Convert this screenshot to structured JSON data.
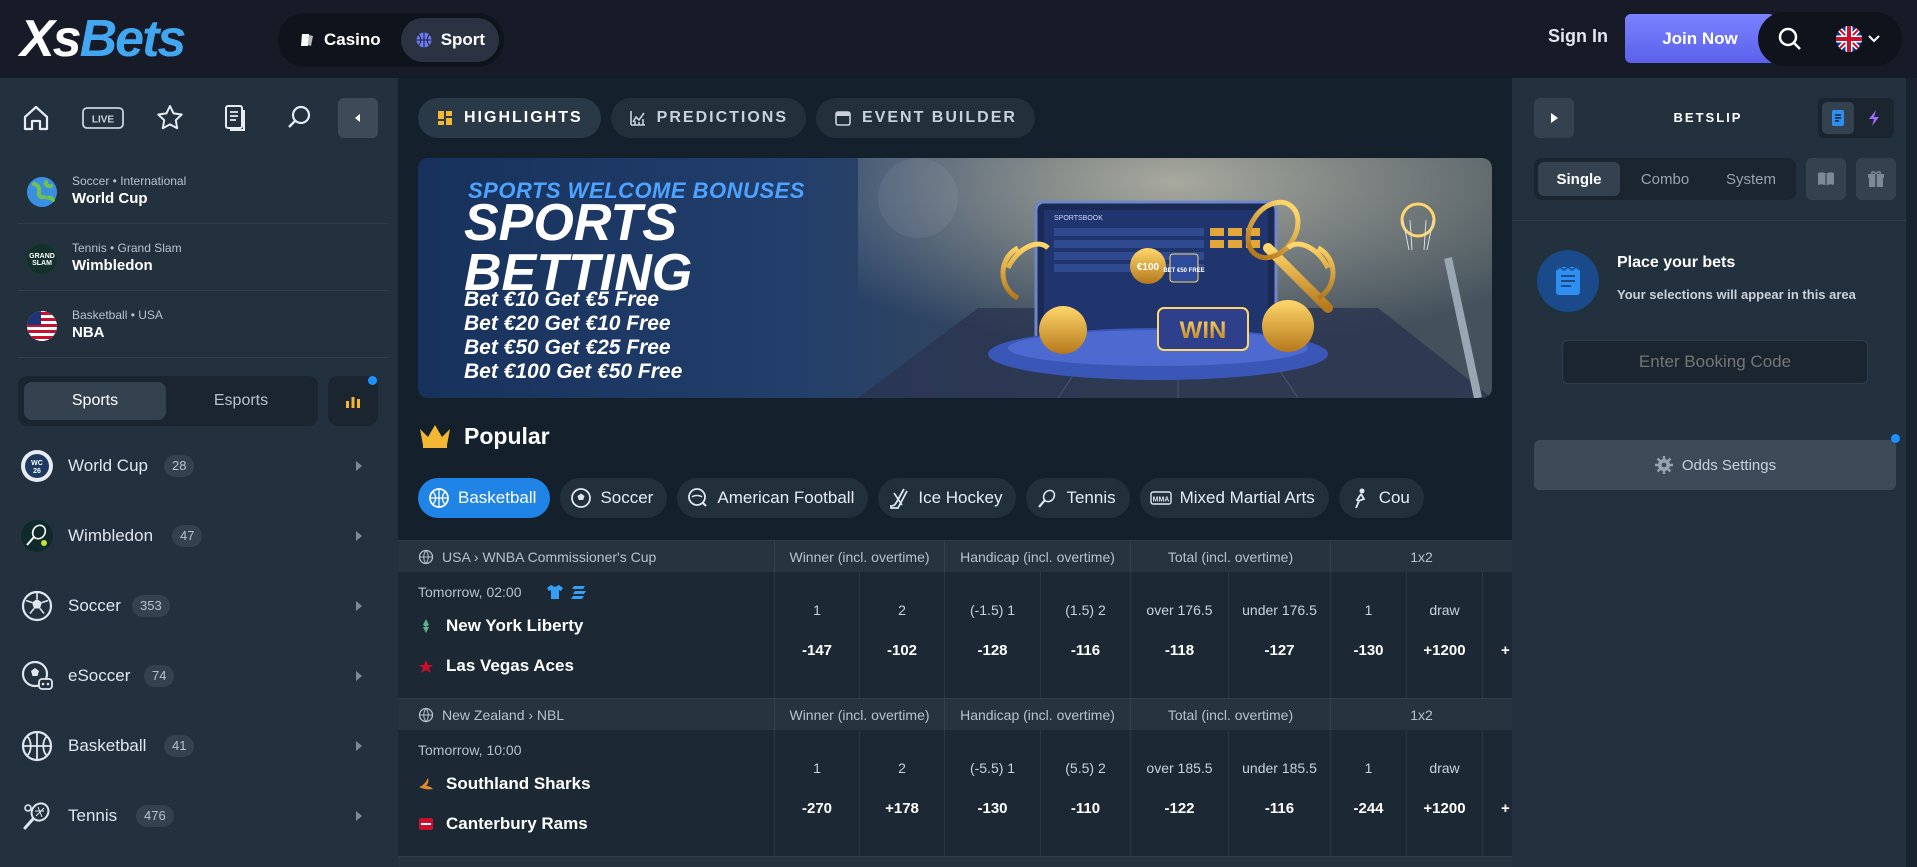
{
  "header": {
    "logo_xs": "Xs",
    "logo_bets": "Bets",
    "products": [
      {
        "label": "Casino",
        "icon": "cards-icon"
      },
      {
        "label": "Sport",
        "icon": "basketball-icon"
      }
    ],
    "sign_in": "Sign In",
    "join_now": "Join Now",
    "language_icon": "uk-flag-icon"
  },
  "left_sidebar": {
    "icons": [
      "home-icon",
      "live-icon",
      "star-icon",
      "betslip-history-icon",
      "search-icon",
      "collapse-icon"
    ],
    "live_label": "LIVE",
    "featured": [
      {
        "subtitle": "Soccer • International",
        "title": "World Cup",
        "icon": "globe-icon"
      },
      {
        "subtitle": "Tennis • Grand Slam",
        "title": "Wimbledon",
        "icon": "grand-slam-icon"
      },
      {
        "subtitle": "Basketball • USA",
        "title": "NBA",
        "icon": "usa-flag-icon"
      }
    ],
    "toggle": {
      "sports": "Sports",
      "esports": "Esports"
    },
    "sports": [
      {
        "name": "World Cup",
        "count": "28",
        "icon": "world-cup-icon"
      },
      {
        "name": "Wimbledon",
        "count": "47",
        "icon": "wimbledon-icon"
      },
      {
        "name": "Soccer",
        "count": "353",
        "icon": "soccer-icon"
      },
      {
        "name": "eSoccer",
        "count": "74",
        "icon": "esoccer-icon"
      },
      {
        "name": "Basketball",
        "count": "41",
        "icon": "basketball-icon"
      },
      {
        "name": "Tennis",
        "count": "476",
        "icon": "tennis-icon"
      }
    ]
  },
  "main": {
    "tabs": [
      {
        "label": "HIGHLIGHTS",
        "icon": "grid-icon"
      },
      {
        "label": "PREDICTIONS",
        "icon": "chart-icon"
      },
      {
        "label": "EVENT BUILDER",
        "icon": "builder-icon"
      }
    ],
    "banner": {
      "small": "SPORTS WELCOME BONUSES",
      "big": "SPORTS BETTING",
      "lines": [
        "Bet €10 Get €5 Free",
        "Bet €20 Get €10 Free",
        "Bet €50 Get €25 Free",
        "Bet €100 Get €50 Free"
      ],
      "screen_title": "SPORTSBOOK",
      "coin_text": "€100",
      "ticket_text": "BET €50 FREE",
      "win_text": "WIN"
    },
    "popular_title": "Popular",
    "sport_chips": [
      "Basketball",
      "Soccer",
      "American Football",
      "Ice Hockey",
      "Tennis",
      "Mixed Martial Arts",
      "Cou"
    ],
    "markets": [
      "Winner (incl. overtime)",
      "Handicap (incl. overtime)",
      "Total (incl. overtime)",
      "1x2"
    ],
    "events": [
      {
        "league": "USA › WNBA Commissioner's Cup",
        "time": "Tomorrow, 02:00",
        "home": "New York Liberty",
        "away": "Las Vegas Aces",
        "odds": [
          {
            "label": "1",
            "value": "-147"
          },
          {
            "label": "2",
            "value": "-102"
          },
          {
            "label": "(-1.5) 1",
            "value": "-128"
          },
          {
            "label": "(1.5) 2",
            "value": "-116"
          },
          {
            "label": "over 176.5",
            "value": "-118"
          },
          {
            "label": "under 176.5",
            "value": "-127"
          },
          {
            "label": "1",
            "value": "-130"
          },
          {
            "label": "draw",
            "value": "+1200"
          },
          {
            "label": "",
            "value": "+"
          }
        ]
      },
      {
        "league": "New Zealand › NBL",
        "time": "Tomorrow, 10:00",
        "home": "Southland Sharks",
        "away": "Canterbury Rams",
        "odds": [
          {
            "label": "1",
            "value": "-270"
          },
          {
            "label": "2",
            "value": "+178"
          },
          {
            "label": "(-5.5) 1",
            "value": "-130"
          },
          {
            "label": "(5.5) 2",
            "value": "-110"
          },
          {
            "label": "over 185.5",
            "value": "-122"
          },
          {
            "label": "under 185.5",
            "value": "-116"
          },
          {
            "label": "1",
            "value": "-244"
          },
          {
            "label": "draw",
            "value": "+1200"
          },
          {
            "label": "",
            "value": "+"
          }
        ]
      }
    ]
  },
  "betslip": {
    "title": "BETSLIP",
    "bet_types": [
      "Single",
      "Combo",
      "System"
    ],
    "empty_title": "Place your bets",
    "empty_subtitle": "Your selections will appear in this area",
    "booking_placeholder": "Enter Booking Code",
    "odds_settings": "Odds Settings"
  },
  "colors": {
    "accent_blue": "#1f84e6",
    "join_purple": "#6a70f5",
    "logo_blue": "#43a6f0",
    "gold": "#f3b733"
  }
}
